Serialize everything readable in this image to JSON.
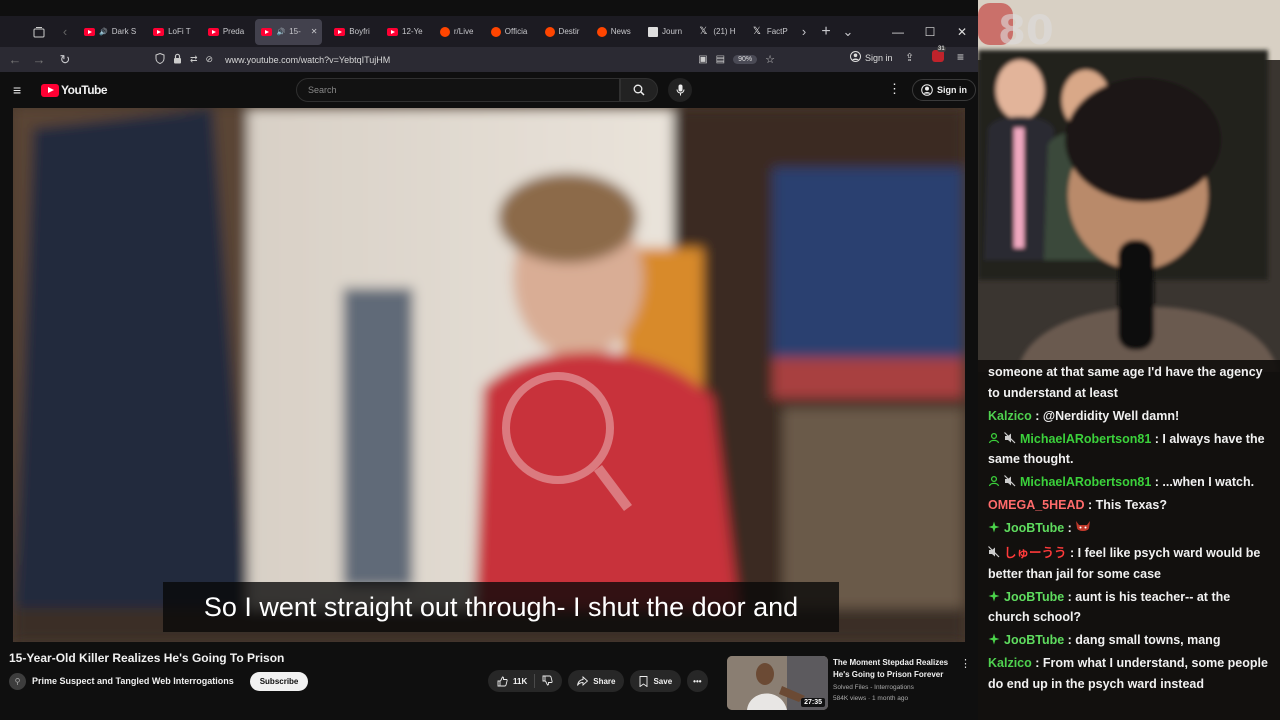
{
  "browser": {
    "tabs": [
      {
        "label": "Dark S",
        "icon": "youtube-favicon",
        "audio": true
      },
      {
        "label": "LoFi T",
        "icon": "youtube-favicon"
      },
      {
        "label": "Preda",
        "icon": "youtube-favicon"
      },
      {
        "label": "15-",
        "icon": "youtube-favicon",
        "audio": true,
        "active": true
      },
      {
        "label": "Boyfri",
        "icon": "youtube-favicon"
      },
      {
        "label": "12-Ye",
        "icon": "youtube-favicon"
      },
      {
        "label": "r/Live",
        "icon": "reddit-favicon"
      },
      {
        "label": "Officia",
        "icon": "reddit-favicon"
      },
      {
        "label": "Destir",
        "icon": "reddit-favicon"
      },
      {
        "label": "News",
        "icon": "reddit-favicon"
      },
      {
        "label": "Journ",
        "icon": "journal-favicon"
      },
      {
        "label": "(21) H",
        "icon": "x-favicon"
      },
      {
        "label": "FactP",
        "icon": "x-favicon"
      }
    ],
    "url": "www.youtube.com/watch?v=YebtqITujHM",
    "zoom": "90%",
    "signin_label": "Sign in",
    "notification_count": "31"
  },
  "youtube": {
    "logo_text": "YouTube",
    "search_placeholder": "Search",
    "signin_label": "Sign in",
    "video": {
      "caption": "So I went straight out through- I shut the door and",
      "title": "15-Year-Old Killer Realizes He's Going To Prison",
      "channel": "Prime Suspect and Tangled Web Interrogations",
      "subscribe_label": "Subscribe",
      "likes": "11K",
      "share_label": "Share",
      "save_label": "Save"
    },
    "recommendation": {
      "title": "The Moment Stepdad Realizes He's Going to Prison Forever",
      "channel": "Solved Files - Interrogations",
      "meta": "584K views · 1 month ago",
      "duration": "27:35"
    }
  },
  "chat": {
    "messages": [
      {
        "user": "",
        "text": "someone at that same age I'd have the agency to understand at least",
        "color": "#f1f1f1",
        "badges": []
      },
      {
        "user": "Kalzico",
        "text": "@Nerdidity Well damn!",
        "color": "#4fd14f",
        "badges": []
      },
      {
        "user": "MichaelARobertson81",
        "text": "I always have the same thought.",
        "color": "#3bd13b",
        "badges": [
          "person",
          "mute"
        ]
      },
      {
        "user": "MichaelARobertson81",
        "text": "...when I watch.",
        "color": "#3bd13b",
        "badges": [
          "person",
          "mute"
        ]
      },
      {
        "user": "OMEGA_5HEAD",
        "text": "This Texas?",
        "color": "#ff6b6b",
        "badges": []
      },
      {
        "user": "JooBTube",
        "text": "",
        "color": "#5fdc5f",
        "badges": [
          "diamond"
        ],
        "emote": true
      },
      {
        "user": "しゅーうう",
        "text": "I feel like psych ward would be better than jail for some case",
        "color": "#ff3a3a",
        "badges": [
          "mute"
        ]
      },
      {
        "user": "JooBTube",
        "text": "aunt is his teacher-- at the church school?",
        "color": "#5fdc5f",
        "badges": [
          "diamond"
        ]
      },
      {
        "user": "JooBTube",
        "text": "dang small towns, mang",
        "color": "#5fdc5f",
        "badges": [
          "diamond"
        ]
      },
      {
        "user": "Kalzico",
        "text": "From what I understand, some people do end up in the psych ward instead",
        "color": "#4fd14f",
        "badges": []
      }
    ]
  },
  "colors": {
    "yt_red": "#ff0033",
    "chat_bg": "#121010"
  }
}
